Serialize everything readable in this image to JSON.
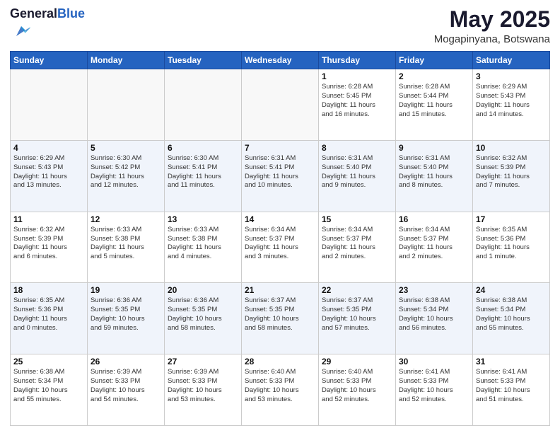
{
  "logo": {
    "general": "General",
    "blue": "Blue"
  },
  "title": {
    "month": "May 2025",
    "location": "Mogapinyana, Botswana"
  },
  "weekdays": [
    "Sunday",
    "Monday",
    "Tuesday",
    "Wednesday",
    "Thursday",
    "Friday",
    "Saturday"
  ],
  "weeks": [
    [
      {
        "day": "",
        "info": ""
      },
      {
        "day": "",
        "info": ""
      },
      {
        "day": "",
        "info": ""
      },
      {
        "day": "",
        "info": ""
      },
      {
        "day": "1",
        "info": "Sunrise: 6:28 AM\nSunset: 5:45 PM\nDaylight: 11 hours\nand 16 minutes."
      },
      {
        "day": "2",
        "info": "Sunrise: 6:28 AM\nSunset: 5:44 PM\nDaylight: 11 hours\nand 15 minutes."
      },
      {
        "day": "3",
        "info": "Sunrise: 6:29 AM\nSunset: 5:43 PM\nDaylight: 11 hours\nand 14 minutes."
      }
    ],
    [
      {
        "day": "4",
        "info": "Sunrise: 6:29 AM\nSunset: 5:43 PM\nDaylight: 11 hours\nand 13 minutes."
      },
      {
        "day": "5",
        "info": "Sunrise: 6:30 AM\nSunset: 5:42 PM\nDaylight: 11 hours\nand 12 minutes."
      },
      {
        "day": "6",
        "info": "Sunrise: 6:30 AM\nSunset: 5:41 PM\nDaylight: 11 hours\nand 11 minutes."
      },
      {
        "day": "7",
        "info": "Sunrise: 6:31 AM\nSunset: 5:41 PM\nDaylight: 11 hours\nand 10 minutes."
      },
      {
        "day": "8",
        "info": "Sunrise: 6:31 AM\nSunset: 5:40 PM\nDaylight: 11 hours\nand 9 minutes."
      },
      {
        "day": "9",
        "info": "Sunrise: 6:31 AM\nSunset: 5:40 PM\nDaylight: 11 hours\nand 8 minutes."
      },
      {
        "day": "10",
        "info": "Sunrise: 6:32 AM\nSunset: 5:39 PM\nDaylight: 11 hours\nand 7 minutes."
      }
    ],
    [
      {
        "day": "11",
        "info": "Sunrise: 6:32 AM\nSunset: 5:39 PM\nDaylight: 11 hours\nand 6 minutes."
      },
      {
        "day": "12",
        "info": "Sunrise: 6:33 AM\nSunset: 5:38 PM\nDaylight: 11 hours\nand 5 minutes."
      },
      {
        "day": "13",
        "info": "Sunrise: 6:33 AM\nSunset: 5:38 PM\nDaylight: 11 hours\nand 4 minutes."
      },
      {
        "day": "14",
        "info": "Sunrise: 6:34 AM\nSunset: 5:37 PM\nDaylight: 11 hours\nand 3 minutes."
      },
      {
        "day": "15",
        "info": "Sunrise: 6:34 AM\nSunset: 5:37 PM\nDaylight: 11 hours\nand 2 minutes."
      },
      {
        "day": "16",
        "info": "Sunrise: 6:34 AM\nSunset: 5:37 PM\nDaylight: 11 hours\nand 2 minutes."
      },
      {
        "day": "17",
        "info": "Sunrise: 6:35 AM\nSunset: 5:36 PM\nDaylight: 11 hours\nand 1 minute."
      }
    ],
    [
      {
        "day": "18",
        "info": "Sunrise: 6:35 AM\nSunset: 5:36 PM\nDaylight: 11 hours\nand 0 minutes."
      },
      {
        "day": "19",
        "info": "Sunrise: 6:36 AM\nSunset: 5:35 PM\nDaylight: 10 hours\nand 59 minutes."
      },
      {
        "day": "20",
        "info": "Sunrise: 6:36 AM\nSunset: 5:35 PM\nDaylight: 10 hours\nand 58 minutes."
      },
      {
        "day": "21",
        "info": "Sunrise: 6:37 AM\nSunset: 5:35 PM\nDaylight: 10 hours\nand 58 minutes."
      },
      {
        "day": "22",
        "info": "Sunrise: 6:37 AM\nSunset: 5:35 PM\nDaylight: 10 hours\nand 57 minutes."
      },
      {
        "day": "23",
        "info": "Sunrise: 6:38 AM\nSunset: 5:34 PM\nDaylight: 10 hours\nand 56 minutes."
      },
      {
        "day": "24",
        "info": "Sunrise: 6:38 AM\nSunset: 5:34 PM\nDaylight: 10 hours\nand 55 minutes."
      }
    ],
    [
      {
        "day": "25",
        "info": "Sunrise: 6:38 AM\nSunset: 5:34 PM\nDaylight: 10 hours\nand 55 minutes."
      },
      {
        "day": "26",
        "info": "Sunrise: 6:39 AM\nSunset: 5:33 PM\nDaylight: 10 hours\nand 54 minutes."
      },
      {
        "day": "27",
        "info": "Sunrise: 6:39 AM\nSunset: 5:33 PM\nDaylight: 10 hours\nand 53 minutes."
      },
      {
        "day": "28",
        "info": "Sunrise: 6:40 AM\nSunset: 5:33 PM\nDaylight: 10 hours\nand 53 minutes."
      },
      {
        "day": "29",
        "info": "Sunrise: 6:40 AM\nSunset: 5:33 PM\nDaylight: 10 hours\nand 52 minutes."
      },
      {
        "day": "30",
        "info": "Sunrise: 6:41 AM\nSunset: 5:33 PM\nDaylight: 10 hours\nand 52 minutes."
      },
      {
        "day": "31",
        "info": "Sunrise: 6:41 AM\nSunset: 5:33 PM\nDaylight: 10 hours\nand 51 minutes."
      }
    ]
  ]
}
